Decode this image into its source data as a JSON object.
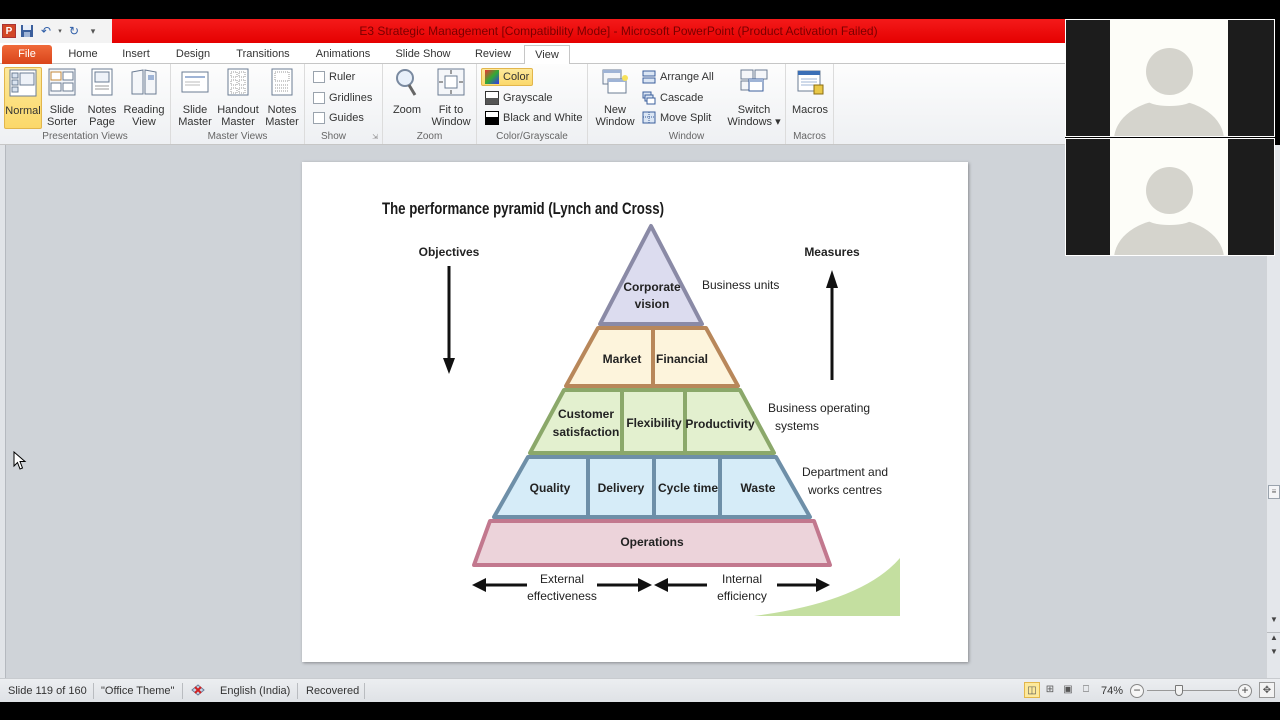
{
  "window": {
    "title": "E3 Strategic Management [Compatibility Mode]  -  Microsoft PowerPoint (Product Activation Failed)",
    "app_icon": "P",
    "quick_access": [
      "save-icon",
      "undo-icon",
      "redo-icon",
      "customize-icon"
    ]
  },
  "tabs": [
    {
      "label": "File"
    },
    {
      "label": "Home"
    },
    {
      "label": "Insert"
    },
    {
      "label": "Design"
    },
    {
      "label": "Transitions"
    },
    {
      "label": "Animations"
    },
    {
      "label": "Slide Show"
    },
    {
      "label": "Review"
    },
    {
      "label": "View",
      "active": true
    }
  ],
  "ribbon": {
    "presentation_views": {
      "label": "Presentation Views",
      "normal": "Normal",
      "slide_sorter": [
        "Slide",
        "Sorter"
      ],
      "notes_page": [
        "Notes",
        "Page"
      ],
      "reading_view": [
        "Reading",
        "View"
      ]
    },
    "master_views": {
      "label": "Master Views",
      "slide_master": [
        "Slide",
        "Master"
      ],
      "handout_master": [
        "Handout",
        "Master"
      ],
      "notes_master": [
        "Notes",
        "Master"
      ]
    },
    "show": {
      "label": "Show",
      "ruler": "Ruler",
      "gridlines": "Gridlines",
      "guides": "Guides"
    },
    "zoom": {
      "label": "Zoom",
      "zoom": "Zoom",
      "fit": [
        "Fit to",
        "Window"
      ]
    },
    "color": {
      "label": "Color/Grayscale",
      "color": "Color",
      "grayscale": "Grayscale",
      "bw": "Black and White"
    },
    "window": {
      "label": "Window",
      "new_window": [
        "New",
        "Window"
      ],
      "arrange_all": "Arrange All",
      "cascade": "Cascade",
      "move_split": "Move Split",
      "switch_windows": [
        "Switch",
        "Windows ▾"
      ]
    },
    "macros": {
      "label": "Macros",
      "macros": "Macros"
    }
  },
  "slide": {
    "title": "The performance pyramid (Lynch and Cross)",
    "objectives": "Objectives",
    "measures": "Measures",
    "levels": {
      "top": [
        "Corporate",
        "vision"
      ],
      "market": "Market",
      "financial": "Financial",
      "customer": [
        "Customer",
        "satisfaction"
      ],
      "flexibility": "Flexibility",
      "productivity": "Productivity",
      "quality": "Quality",
      "delivery": "Delivery",
      "cycle_time": "Cycle time",
      "waste": "Waste",
      "operations": "Operations"
    },
    "side_labels": {
      "business_units": "Business units",
      "bos": [
        "Business operating",
        "systems"
      ],
      "dept": [
        "Department and",
        "works centres"
      ]
    },
    "bottom": {
      "external": [
        "External",
        "effectiveness"
      ],
      "internal": [
        "Internal",
        "efficiency"
      ]
    },
    "colors": {
      "top_fill": "#dcdcef",
      "top_stroke": "#8a8aa6",
      "tier2_fill": "#fdf4dc",
      "tier2_stroke": "#b8875a",
      "tier3_fill": "#e3f0cf",
      "tier3_stroke": "#8ba86a",
      "tier4_fill": "#d6ecf8",
      "tier4_stroke": "#6e8fa8",
      "base_fill": "#ecd3da",
      "base_stroke": "#c2788e",
      "wedge": "#c4dfa0"
    }
  },
  "statusbar": {
    "slide_info": "Slide 119 of 160",
    "theme": "\"Office Theme\"",
    "language": "English (India)",
    "recovered": "Recovered",
    "zoom": "74%"
  }
}
